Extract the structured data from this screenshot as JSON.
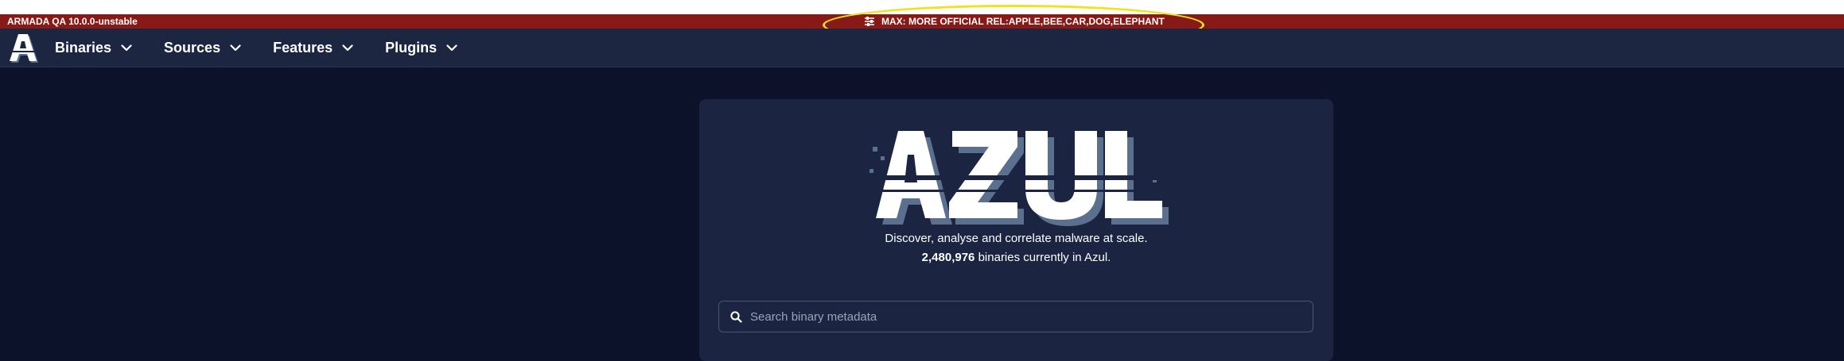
{
  "banner": {
    "environment_label": "ARMADA QA 10.0.0-unstable",
    "classification_text": "MAX: MORE OFFICIAL REL:APPLE,BEE,CAR,DOG,ELEPHANT",
    "classification_icon": "sliders-icon",
    "background_color": "#871a17",
    "highlight_color": "#f1e21c"
  },
  "navbar": {
    "logo": "A",
    "items": [
      {
        "label": "Binaries",
        "icon": "chevron-down-icon"
      },
      {
        "label": "Sources",
        "icon": "chevron-down-icon"
      },
      {
        "label": "Features",
        "icon": "chevron-down-icon"
      },
      {
        "label": "Plugins",
        "icon": "chevron-down-icon"
      }
    ]
  },
  "hero": {
    "logo_text": "AZUL",
    "tagline": "Discover, analyse and correlate malware at scale.",
    "binary_count": "2,480,976",
    "count_suffix": "binaries currently in Azul."
  },
  "search": {
    "placeholder": "Search binary metadata",
    "value": ""
  }
}
